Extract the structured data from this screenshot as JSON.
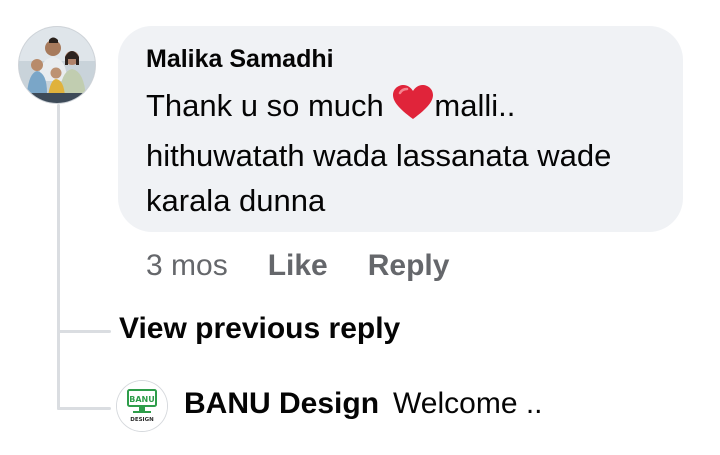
{
  "comment": {
    "author": "Malika Samadhi",
    "text_before_emoji": "Thank u so much ",
    "emoji": "red-heart-icon",
    "text_after_emoji": "malli.. hithuwatath wada lassanata wade karala dunna",
    "time": "3 mos",
    "like_label": "Like",
    "reply_label": "Reply"
  },
  "view_previous_reply": "View previous reply",
  "reply": {
    "author": "BANU Design",
    "text": "Welcome ..",
    "avatar_logo_text_top": "BANU",
    "avatar_logo_text_bottom": "DESIGN"
  },
  "colors": {
    "bubble_bg": "#f0f2f5",
    "secondary_text": "#65676b",
    "thread_line": "#dadde1",
    "heart": "#e0243a",
    "logo_green": "#2e9d4a"
  }
}
